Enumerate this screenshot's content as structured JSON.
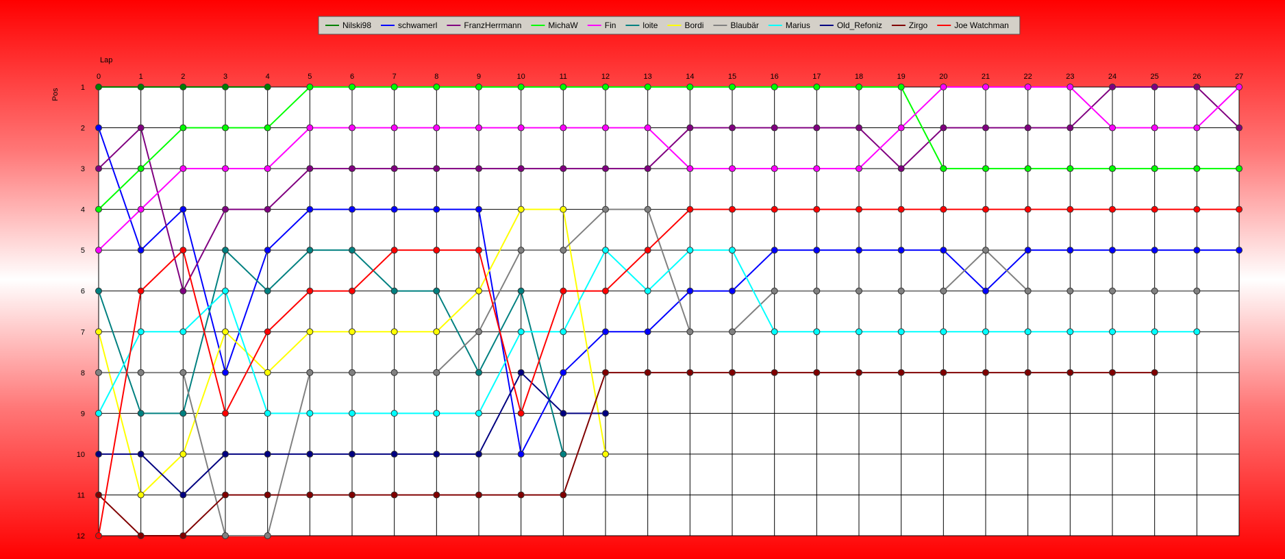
{
  "chart_data": {
    "type": "line",
    "xlabel": "Lap",
    "ylabel": "Pos",
    "x": [
      0,
      1,
      2,
      3,
      4,
      5,
      6,
      7,
      8,
      9,
      10,
      11,
      12,
      13,
      14,
      15,
      16,
      17,
      18,
      19,
      20,
      21,
      22,
      23,
      24,
      25,
      26,
      27
    ],
    "xlim": [
      0,
      27
    ],
    "ylim": [
      1,
      12
    ],
    "y_inverted": true,
    "y_ticks": [
      1,
      2,
      3,
      4,
      5,
      6,
      7,
      8,
      9,
      10,
      11,
      12
    ],
    "grid": true,
    "legend_position": "top",
    "series": [
      {
        "name": "Nilski98",
        "color": "#008000",
        "values": [
          1,
          1,
          1,
          1,
          1
        ]
      },
      {
        "name": "schwamerl",
        "color": "#0000ff",
        "values": [
          2,
          5,
          4,
          8,
          5,
          4,
          4,
          4,
          4,
          4,
          10,
          8,
          7,
          7,
          6,
          6,
          5,
          5,
          5,
          5,
          5,
          6,
          5,
          5,
          5,
          5,
          5,
          5
        ]
      },
      {
        "name": "FranzHerrmann",
        "color": "#800080",
        "values": [
          3,
          2,
          6,
          4,
          4,
          3,
          3,
          3,
          3,
          3,
          3,
          3,
          3,
          3,
          2,
          2,
          2,
          2,
          2,
          3,
          2,
          2,
          2,
          2,
          1,
          1,
          1,
          2
        ]
      },
      {
        "name": "MichaW",
        "color": "#00ff00",
        "values": [
          4,
          3,
          2,
          2,
          2,
          1,
          1,
          1,
          1,
          1,
          1,
          1,
          1,
          1,
          1,
          1,
          1,
          1,
          1,
          1,
          3,
          3,
          3,
          3,
          3,
          3,
          3,
          3
        ]
      },
      {
        "name": "Fin",
        "color": "#ff00ff",
        "values": [
          5,
          4,
          3,
          3,
          3,
          2,
          2,
          2,
          2,
          2,
          2,
          2,
          2,
          2,
          3,
          3,
          3,
          3,
          3,
          2,
          1,
          1,
          1,
          1,
          2,
          2,
          2,
          1
        ]
      },
      {
        "name": "loite",
        "color": "#008080",
        "values": [
          6,
          9,
          9,
          5,
          6,
          5,
          5,
          6,
          6,
          8,
          6,
          10
        ]
      },
      {
        "name": "Bordi",
        "color": "#ffff00",
        "values": [
          7,
          11,
          10,
          7,
          8,
          7,
          7,
          7,
          7,
          6,
          4,
          4,
          10
        ]
      },
      {
        "name": "Blaubär",
        "color": "#808080",
        "values": [
          8,
          8,
          8,
          12,
          12,
          8,
          8,
          8,
          8,
          7,
          5,
          5,
          4,
          4,
          7,
          7,
          6,
          6,
          6,
          6,
          6,
          5,
          6,
          6,
          6,
          6,
          6
        ]
      },
      {
        "name": "Marius",
        "color": "#00ffff",
        "values": [
          9,
          7,
          7,
          6,
          9,
          9,
          9,
          9,
          9,
          9,
          7,
          7,
          5,
          6,
          5,
          5,
          7,
          7,
          7,
          7,
          7,
          7,
          7,
          7,
          7,
          7,
          7
        ]
      },
      {
        "name": "Old_Refoniz",
        "color": "#000080",
        "values": [
          10,
          10,
          11,
          10,
          10,
          10,
          10,
          10,
          10,
          10,
          8,
          9,
          9
        ]
      },
      {
        "name": "Zirgo",
        "color": "#800000",
        "values": [
          11,
          12,
          12,
          11,
          11,
          11,
          11,
          11,
          11,
          11,
          11,
          11,
          8,
          8,
          8,
          8,
          8,
          8,
          8,
          8,
          8,
          8,
          8,
          8,
          8,
          8
        ]
      },
      {
        "name": "Joe Watchman",
        "color": "#ff0000",
        "values": [
          12,
          6,
          5,
          9,
          7,
          6,
          6,
          5,
          5,
          5,
          9,
          6,
          6,
          5,
          4,
          4,
          4,
          4,
          4,
          4,
          4,
          4,
          4,
          4,
          4,
          4,
          4,
          4
        ]
      }
    ]
  }
}
